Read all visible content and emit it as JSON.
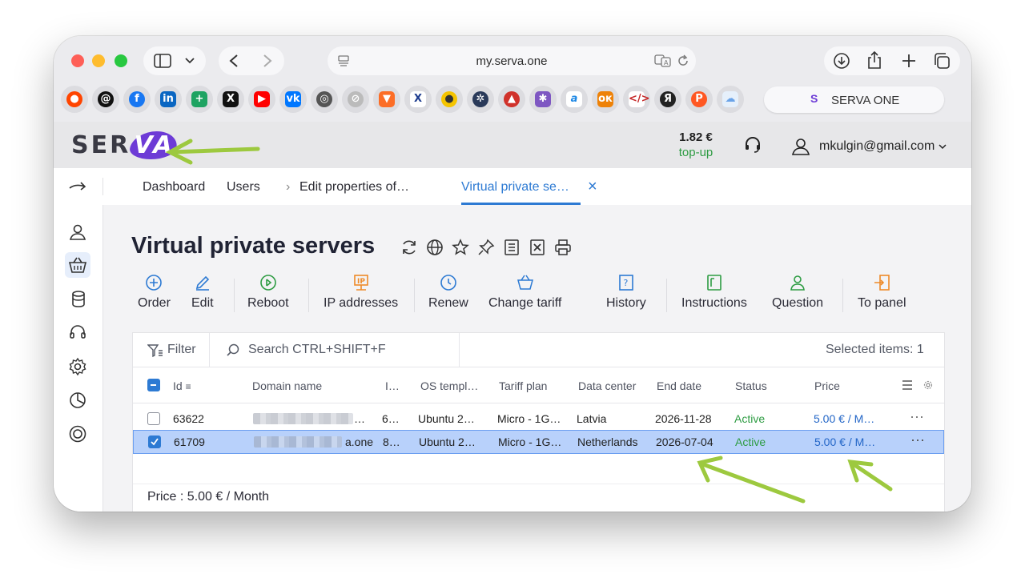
{
  "browser": {
    "url": "my.serva.one",
    "tab_title": "SERVA ONE"
  },
  "header": {
    "logo": "SERVA",
    "balance": "1.82 €",
    "topup": "top-up",
    "user_email": "mkulgin@gmail.com"
  },
  "breadcrumbs": {
    "dashboard": "Dashboard",
    "users": "Users",
    "separator": "›",
    "edit": "Edit properties of…",
    "current": "Virtual private se…",
    "close": "×"
  },
  "page": {
    "title": "Virtual private servers"
  },
  "toolbar": {
    "order": "Order",
    "edit": "Edit",
    "reboot": "Reboot",
    "ip": "IP addresses",
    "renew": "Renew",
    "change_tariff": "Change tariff",
    "history": "History",
    "instructions": "Instructions",
    "question": "Question",
    "to_panel": "To panel"
  },
  "filterbar": {
    "filter": "Filter",
    "search_placeholder": "Search CTRL+SHIFT+F",
    "selected": "Selected items: 1"
  },
  "table": {
    "headers": {
      "id": "Id",
      "domain": "Domain name",
      "ip": "I…",
      "os": "OS templ…",
      "tariff": "Tariff plan",
      "dc": "Data center",
      "end": "End date",
      "status": "Status",
      "price": "Price"
    },
    "rows": [
      {
        "id": "63622",
        "domain": "…",
        "ip": "6…",
        "os": "Ubuntu 2…",
        "tariff": "Micro - 1G…",
        "dc": "Latvia",
        "end": "2026-11-28",
        "status": "Active",
        "price": "5.00 € / M…",
        "more": "⋯",
        "checked": false
      },
      {
        "id": "61709",
        "domain": "a.one",
        "ip": "8…",
        "os": "Ubuntu 2…",
        "tariff": "Micro - 1G…",
        "dc": "Netherlands",
        "end": "2026-07-04",
        "status": "Active",
        "price": "5.00 € / M…",
        "more": "⋯",
        "checked": true
      }
    ]
  },
  "footer": {
    "price": "Price : 5.00 € / Month"
  },
  "colors": {
    "accent": "#2d7ad3",
    "active_green": "#2e9c43",
    "selected_row": "#b8d1fb",
    "annotation_arrow": "#9dc93f"
  }
}
